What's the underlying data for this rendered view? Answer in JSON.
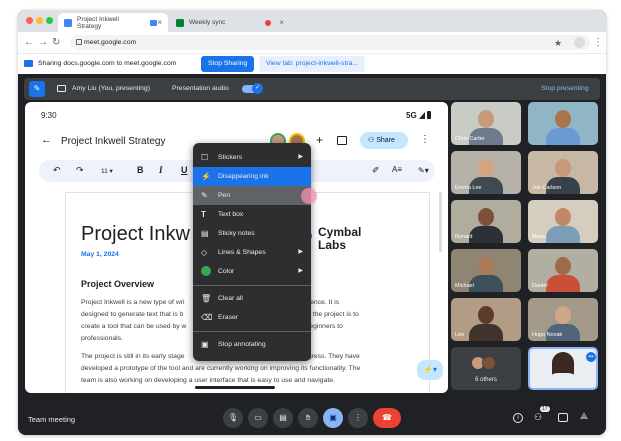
{
  "browser": {
    "tabs": [
      {
        "title": "Project Inkwell Strategy",
        "favicon_color": "#4285f4"
      },
      {
        "title": "Weekly sync",
        "favicon_color": "#00832d"
      }
    ],
    "address": "meet.google.com"
  },
  "share_banner": {
    "text": "Sharing docs.google.com to meet.google.com",
    "stop_sharing": "Stop Sharing",
    "view_tab": "View tab: project-inkwell-stra..."
  },
  "presenting_bar": {
    "presenter": "Amy Liu (You, presenting)",
    "audio": "Presentation audio",
    "stop": "Stop presenting"
  },
  "phone": {
    "time": "9:30",
    "network": "5G",
    "doc_name": "Project Inkwell Strategy",
    "share_label": "Share",
    "font_size": "11",
    "doc": {
      "title": "Project Inkw",
      "date": "May 1, 2024",
      "logo_line1": "Cymbal",
      "logo_line2": "Labs",
      "heading": "Project Overview",
      "p1": [
        "Project Inkwell is a new type of wri",
        "designed to generate text that is b",
        "create a tool that can be used by w",
        "professionals."
      ],
      "p1_right": [
        "elligence. It is",
        "al of the project is to",
        "m beginners to"
      ],
      "p2": [
        "The project is still in its early stage",
        "developed a prototype of the tool and are currently working on improving its functionality. The",
        "team is also working on developing a user interface that is easy to use and navigate."
      ],
      "p2_right": "progress. They have"
    }
  },
  "menu": {
    "items": [
      {
        "label": "Stickers",
        "icon": "sticker-icon",
        "submenu": true
      },
      {
        "label": "Disappearing ink",
        "icon": "pen-icon",
        "state": "active"
      },
      {
        "label": "Pen",
        "icon": "pen-icon",
        "state": "hover"
      },
      {
        "label": "Text box",
        "icon": "text-icon"
      },
      {
        "label": "Sticky notes",
        "icon": "note-icon"
      },
      {
        "label": "Lines & Shapes",
        "icon": "shapes-icon",
        "submenu": true
      },
      {
        "label": "Color",
        "icon": "color-swatch-icon",
        "submenu": true
      },
      {
        "label": "Clear all",
        "icon": "trash-icon"
      },
      {
        "label": "Eraser",
        "icon": "eraser-icon"
      },
      {
        "label": "Stop annotating",
        "icon": "stop-icon"
      }
    ]
  },
  "participants": [
    {
      "name": "Chris Carter",
      "bg": "#c9cbc5",
      "skin": "#c79a7a",
      "shirt": "#6f7b8c"
    },
    {
      "name": "",
      "bg": "#8fb5c7",
      "skin": "#a9754e",
      "shirt": "#6a9ad2"
    },
    {
      "name": "Emma Lee",
      "bg": "#b6b2aa",
      "skin": "#d3a582",
      "shirt": "#3f4a52"
    },
    {
      "name": "Joe Carlson",
      "bg": "#c7b7a5",
      "skin": "#c89878",
      "shirt": "#36414a"
    },
    {
      "name": "Ronald",
      "bg": "#b1ad9e",
      "skin": "#7b5238",
      "shirt": "#2c3138"
    },
    {
      "name": "Maria",
      "bg": "#d5cdbd",
      "skin": "#c08868",
      "shirt": "#7e9db7"
    },
    {
      "name": "Michael",
      "bg": "#8f8572",
      "skin": "#a87a5a",
      "shirt": "#40505a"
    },
    {
      "name": "Daniel",
      "bg": "#b3aea2",
      "skin": "#9b6b4c",
      "shirt": "#c94f38"
    },
    {
      "name": "Lee",
      "bg": "#b29c86",
      "skin": "#5c3c2c",
      "shirt": "#40342c"
    },
    {
      "name": "Hugo Novak",
      "bg": "#a39a89",
      "skin": "#d0a888",
      "shirt": "#50647a"
    }
  ],
  "others": {
    "label": "6 others"
  },
  "self_tile": {
    "bg": "#eaedf2",
    "skin": "#c9a083",
    "shirt": "#e9eef5"
  },
  "bottom_bar": {
    "meeting_name": "Team meeting",
    "participant_count": "17"
  },
  "colors": {
    "meet_bg": "#202124",
    "accent_blue": "#1a73e8",
    "stop_red": "#ea4335",
    "menu_bg": "#2d2e30"
  }
}
